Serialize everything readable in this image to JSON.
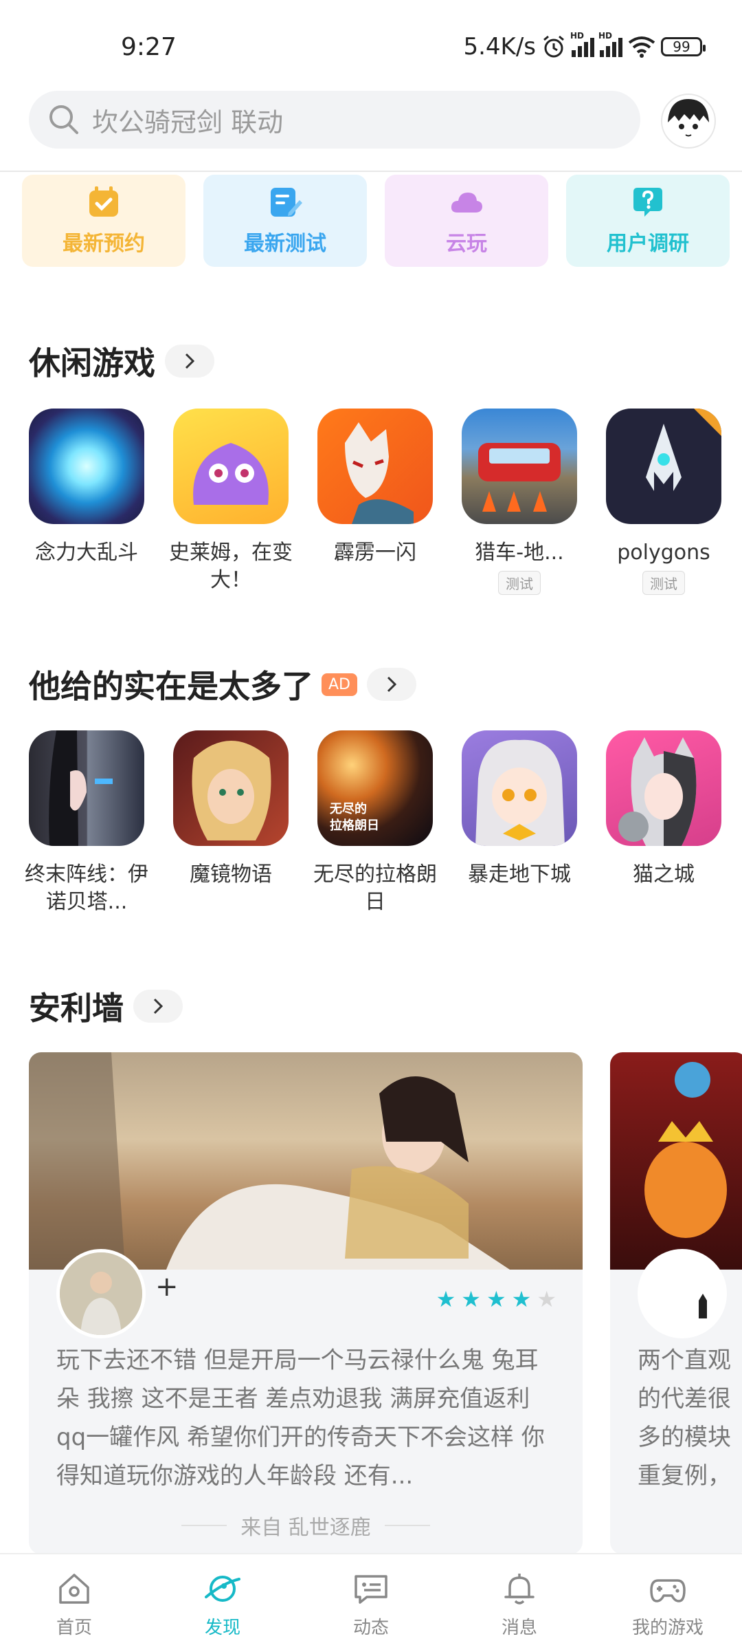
{
  "status_bar": {
    "time": "9:27",
    "net_speed": "5.4K/s",
    "battery": "99"
  },
  "search": {
    "placeholder": "坎公骑冠剑 联动"
  },
  "quick_entries": [
    {
      "label": "最新预约",
      "color": "#f4b536",
      "bg": "#fff4e0"
    },
    {
      "label": "最新测试",
      "color": "#3aa6ef",
      "bg": "#e5f4fd"
    },
    {
      "label": "云玩",
      "color": "#c784e6",
      "bg": "#f8e9fb"
    },
    {
      "label": "用户调研",
      "color": "#22c1cf",
      "bg": "#e3f7f8"
    }
  ],
  "section_casual": {
    "title": "休闲游戏",
    "games": [
      {
        "name": "念力大乱斗",
        "tag": ""
      },
      {
        "name": "史莱姆，在变大！",
        "tag": ""
      },
      {
        "name": "霹雳一闪",
        "tag": ""
      },
      {
        "name": "猎车-地...",
        "tag": "测试"
      },
      {
        "name": "polygons",
        "tag": "测试"
      }
    ]
  },
  "section_ad": {
    "title": "他给的实在是太多了",
    "ad_label": "AD",
    "games": [
      {
        "name": "终末阵线：伊诺贝塔..."
      },
      {
        "name": "魔镜物语"
      },
      {
        "name": "无尽的拉格朗日"
      },
      {
        "name": "暴走地下城"
      },
      {
        "name": "猫之城"
      }
    ]
  },
  "section_recommend": {
    "title": "安利墙",
    "cards": [
      {
        "follow": "+",
        "rating": 4,
        "review": "玩下去还不错 但是开局一个马云禄什么鬼 兔耳朵 我擦 这不是王者 差点劝退我 满屏充值返利 qq一罐作风 希望你们开的传奇天下不会这样 你得知道玩你游戏的人年龄段 还有...",
        "from": "来自 乱世逐鹿"
      },
      {
        "review": "两个直观的代差很多的模块重复例，左上"
      }
    ]
  },
  "bottom_nav": [
    {
      "label": "首页",
      "icon": "home-icon",
      "active": false
    },
    {
      "label": "发现",
      "icon": "discover-planet-icon",
      "active": true
    },
    {
      "label": "动态",
      "icon": "chat-feed-icon",
      "active": false
    },
    {
      "label": "消息",
      "icon": "bell-icon",
      "active": false
    },
    {
      "label": "我的游戏",
      "icon": "gamepad-icon",
      "active": false
    }
  ],
  "colors": {
    "accent": "#16b9c7",
    "star": "#1fbfcf",
    "ad": "#ff8f59"
  }
}
